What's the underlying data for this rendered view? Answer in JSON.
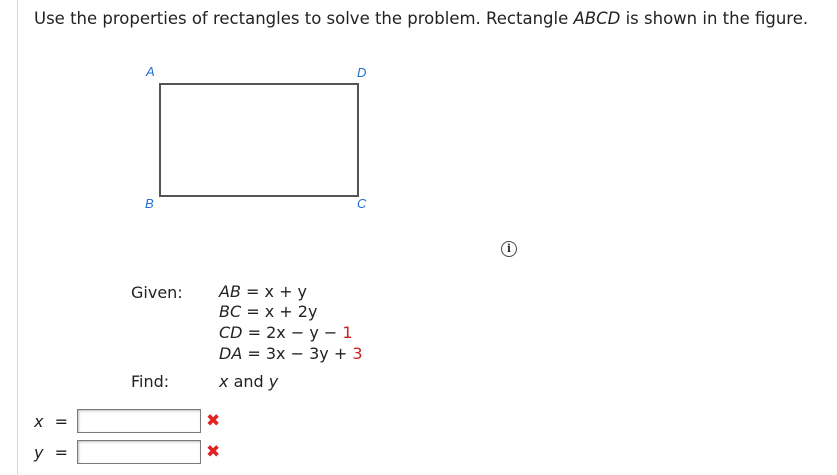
{
  "prompt": {
    "before": "Use the properties of rectangles to solve the problem. Rectangle ",
    "name": "ABCD",
    "after": " is shown in the figure."
  },
  "figure": {
    "vertices": {
      "a": "A",
      "b": "B",
      "c": "C",
      "d": "D"
    },
    "vertex_color": "#1f6fd1"
  },
  "info_icon": {
    "symbol": "i"
  },
  "given": {
    "label": "Given:",
    "ab": {
      "name": "AB",
      "expr": "= x + y"
    },
    "bc": {
      "name": "BC",
      "expr": "= x + 2y"
    },
    "cd": {
      "name": "CD",
      "expr": "= 2x − y −",
      "const": "1"
    },
    "da": {
      "name": "DA",
      "expr": "= 3x − 3y +",
      "const": "3"
    }
  },
  "find": {
    "label": "Find:",
    "v1": "x",
    "conj": "and",
    "v2": "y"
  },
  "answers": {
    "x": {
      "label": "x",
      "eq": "=",
      "value": "",
      "status": "✖"
    },
    "y": {
      "label": "y",
      "eq": "=",
      "value": "",
      "status": "✖"
    }
  },
  "colors": {
    "error": "#e02424",
    "highlight_constant": "#cc1f1f"
  }
}
